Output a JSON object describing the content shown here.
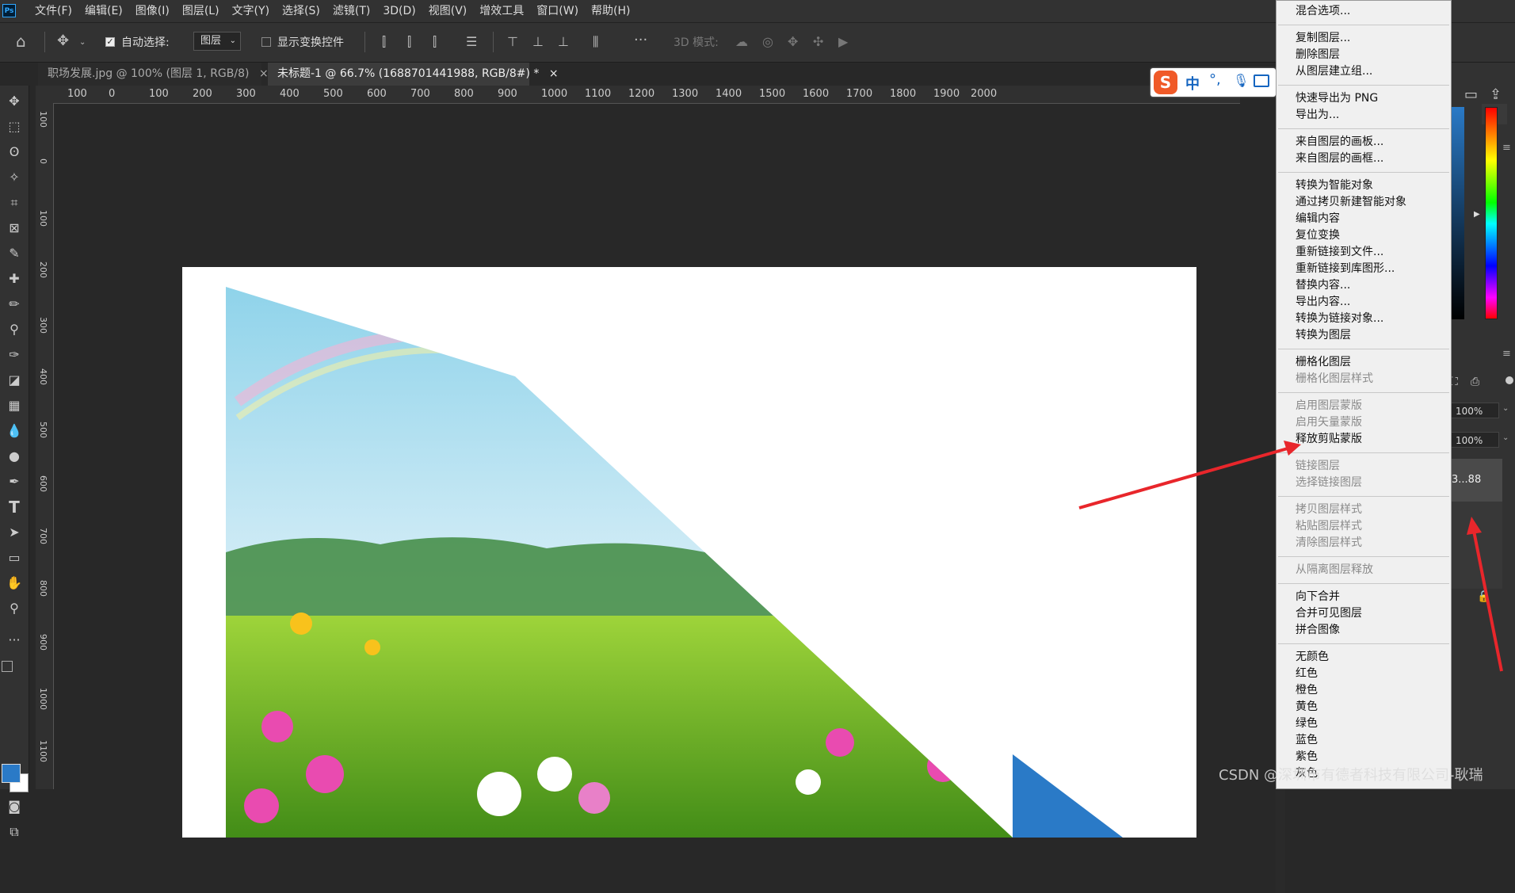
{
  "app": {
    "logo": "Ps"
  },
  "menu": [
    "文件(F)",
    "编辑(E)",
    "图像(I)",
    "图层(L)",
    "文字(Y)",
    "选择(S)",
    "滤镜(T)",
    "3D(D)",
    "视图(V)",
    "增效工具",
    "窗口(W)",
    "帮助(H)"
  ],
  "options": {
    "auto_select_label": "自动选择:",
    "auto_select_value": "图层",
    "show_transform_label": "显示变换控件",
    "mode3d_label": "3D 模式:"
  },
  "tabs": [
    {
      "label": "职场发展.jpg @ 100% (图层 1, RGB/8)",
      "close": "×"
    },
    {
      "label": "未标题-1 @ 66.7% (1688701441988, RGB/8#) *",
      "close": "×"
    }
  ],
  "ruler_h": [
    "100",
    "0",
    "100",
    "200",
    "300",
    "400",
    "500",
    "600",
    "700",
    "800",
    "900",
    "1000",
    "1100",
    "1200",
    "1300",
    "1400",
    "1500",
    "1600",
    "1700",
    "1800",
    "1900",
    "2000"
  ],
  "ruler_v": [
    "100",
    "0",
    "100",
    "200",
    "300",
    "400",
    "500",
    "600",
    "700",
    "800",
    "900",
    "1000",
    "1100"
  ],
  "ime": {
    "chinese": "中"
  },
  "right_panel": {
    "opacity1": "100%",
    "opacity2": "100%",
    "layer_name_tail": "3...88"
  },
  "context_menu": [
    [
      {
        "label": "混合选项...",
        "enabled": true
      }
    ],
    [
      {
        "label": "复制图层...",
        "enabled": true
      },
      {
        "label": "删除图层",
        "enabled": true
      },
      {
        "label": "从图层建立组...",
        "enabled": true
      }
    ],
    [
      {
        "label": "快速导出为 PNG",
        "enabled": true
      },
      {
        "label": "导出为...",
        "enabled": true
      }
    ],
    [
      {
        "label": "来自图层的画板...",
        "enabled": true
      },
      {
        "label": "来自图层的画框...",
        "enabled": true
      }
    ],
    [
      {
        "label": "转换为智能对象",
        "enabled": true
      },
      {
        "label": "通过拷贝新建智能对象",
        "enabled": true
      },
      {
        "label": "编辑内容",
        "enabled": true
      },
      {
        "label": "复位变换",
        "enabled": true
      },
      {
        "label": "重新链接到文件...",
        "enabled": true
      },
      {
        "label": "重新链接到库图形...",
        "enabled": true
      },
      {
        "label": "替换内容...",
        "enabled": true
      },
      {
        "label": "导出内容...",
        "enabled": true
      },
      {
        "label": "转换为链接对象...",
        "enabled": true
      },
      {
        "label": "转换为图层",
        "enabled": true
      }
    ],
    [
      {
        "label": "栅格化图层",
        "enabled": true
      },
      {
        "label": "栅格化图层样式",
        "enabled": false
      }
    ],
    [
      {
        "label": "启用图层蒙版",
        "enabled": false
      },
      {
        "label": "启用矢量蒙版",
        "enabled": false
      },
      {
        "label": "释放剪贴蒙版",
        "enabled": true
      }
    ],
    [
      {
        "label": "链接图层",
        "enabled": false
      },
      {
        "label": "选择链接图层",
        "enabled": false
      }
    ],
    [
      {
        "label": "拷贝图层样式",
        "enabled": false
      },
      {
        "label": "粘贴图层样式",
        "enabled": false
      },
      {
        "label": "清除图层样式",
        "enabled": false
      }
    ],
    [
      {
        "label": "从隔离图层释放",
        "enabled": false
      }
    ],
    [
      {
        "label": "向下合并",
        "enabled": true
      },
      {
        "label": "合并可见图层",
        "enabled": true
      },
      {
        "label": "拼合图像",
        "enabled": true
      }
    ],
    [
      {
        "label": "无颜色",
        "enabled": true
      },
      {
        "label": "红色",
        "enabled": true
      },
      {
        "label": "橙色",
        "enabled": true
      },
      {
        "label": "黄色",
        "enabled": true
      },
      {
        "label": "绿色",
        "enabled": true
      },
      {
        "label": "蓝色",
        "enabled": true
      },
      {
        "label": "紫色",
        "enabled": true
      },
      {
        "label": "灰色",
        "enabled": true
      }
    ]
  ],
  "watermark": "CSDN @深圳市有德者科技有限公司-耿瑞",
  "colors": {
    "foreground": "#2a7ac7",
    "background": "#ffffff",
    "arrow": "#e8262b"
  }
}
